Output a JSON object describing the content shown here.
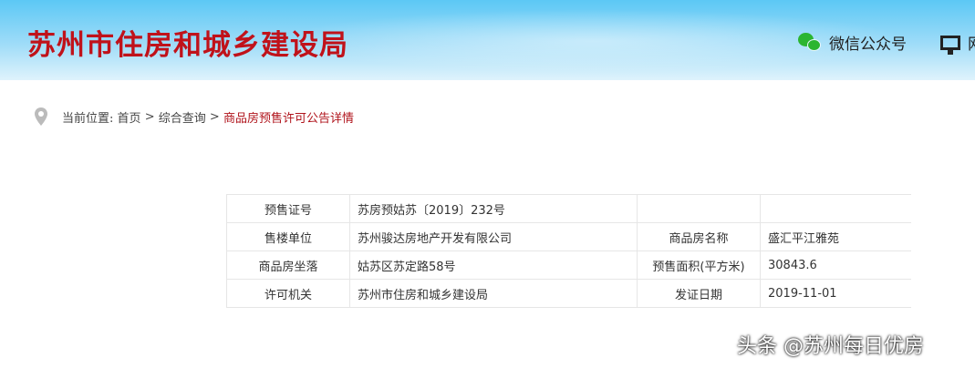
{
  "header": {
    "site_title": "苏州市住房和城乡建设局",
    "wechat_label": "微信公众号",
    "pc_label": "网"
  },
  "breadcrumb": {
    "prefix": "当前位置:",
    "items": [
      "首页",
      "综合查询"
    ],
    "separator": ">",
    "current": "商品房预售许可公告详情"
  },
  "table": {
    "rows": [
      [
        "预售证号",
        "苏房预姑苏〔2019〕232号",
        "",
        ""
      ],
      [
        "售楼单位",
        "苏州骏达房地产开发有限公司",
        "商品房名称",
        "盛汇平江雅苑"
      ],
      [
        "商品房坐落",
        "姑苏区苏定路58号",
        "预售面积(平方米)",
        "30843.6"
      ],
      [
        "许可机关",
        "苏州市住房和城乡建设局",
        "发证日期",
        "2019-11-01"
      ]
    ]
  },
  "watermark": "头条 @苏州每日优房"
}
